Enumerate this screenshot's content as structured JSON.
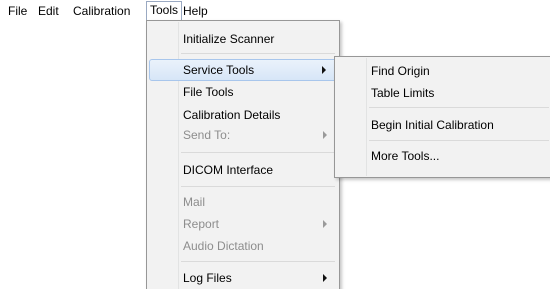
{
  "menubar": {
    "items": [
      {
        "label": "File"
      },
      {
        "label": "Edit"
      },
      {
        "label": "Calibration"
      },
      {
        "label": "Tools",
        "open": true
      },
      {
        "label": "Help"
      }
    ]
  },
  "tools_menu": {
    "items": [
      {
        "label": "Initialize Scanner",
        "enabled": true
      },
      {
        "label": "Service Tools",
        "enabled": true,
        "submenu": true,
        "highlighted": true
      },
      {
        "label": "File Tools",
        "enabled": true
      },
      {
        "label": "Calibration Details",
        "enabled": true
      },
      {
        "label": "Send To:",
        "enabled": false,
        "submenu": true
      },
      {
        "label": "DICOM Interface",
        "enabled": true
      },
      {
        "label": "Mail",
        "enabled": false
      },
      {
        "label": "Report",
        "enabled": false,
        "submenu": true
      },
      {
        "label": "Audio Dictation",
        "enabled": false
      },
      {
        "label": "Log Files",
        "enabled": true,
        "submenu": true
      }
    ]
  },
  "service_tools_submenu": {
    "items": [
      {
        "label": "Find Origin"
      },
      {
        "label": "Table Limits"
      },
      {
        "label": "Begin Initial Calibration"
      },
      {
        "label": "More Tools..."
      }
    ]
  },
  "colors": {
    "menu_background": "#f2f2f2",
    "highlight": "#d7e6f7",
    "disabled_text": "#8d8d8d"
  }
}
